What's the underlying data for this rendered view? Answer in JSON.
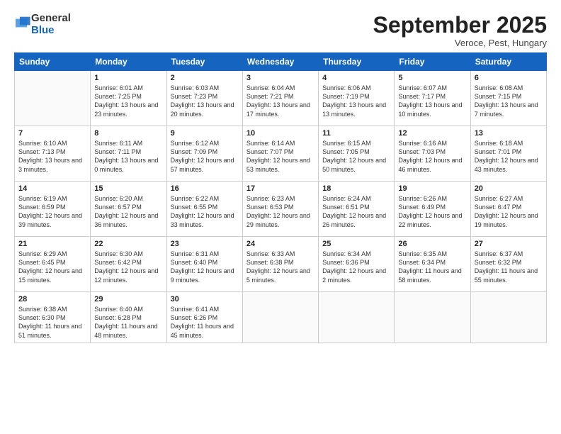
{
  "header": {
    "logo_general": "General",
    "logo_blue": "Blue",
    "title": "September 2025",
    "subtitle": "Veroce, Pest, Hungary"
  },
  "columns": [
    "Sunday",
    "Monday",
    "Tuesday",
    "Wednesday",
    "Thursday",
    "Friday",
    "Saturday"
  ],
  "weeks": [
    [
      {
        "num": "",
        "sunrise": "",
        "sunset": "",
        "daylight": ""
      },
      {
        "num": "1",
        "sunrise": "6:01 AM",
        "sunset": "7:25 PM",
        "daylight": "13 hours and 23 minutes."
      },
      {
        "num": "2",
        "sunrise": "6:03 AM",
        "sunset": "7:23 PM",
        "daylight": "13 hours and 20 minutes."
      },
      {
        "num": "3",
        "sunrise": "6:04 AM",
        "sunset": "7:21 PM",
        "daylight": "13 hours and 17 minutes."
      },
      {
        "num": "4",
        "sunrise": "6:06 AM",
        "sunset": "7:19 PM",
        "daylight": "13 hours and 13 minutes."
      },
      {
        "num": "5",
        "sunrise": "6:07 AM",
        "sunset": "7:17 PM",
        "daylight": "13 hours and 10 minutes."
      },
      {
        "num": "6",
        "sunrise": "6:08 AM",
        "sunset": "7:15 PM",
        "daylight": "13 hours and 7 minutes."
      }
    ],
    [
      {
        "num": "7",
        "sunrise": "6:10 AM",
        "sunset": "7:13 PM",
        "daylight": "13 hours and 3 minutes."
      },
      {
        "num": "8",
        "sunrise": "6:11 AM",
        "sunset": "7:11 PM",
        "daylight": "13 hours and 0 minutes."
      },
      {
        "num": "9",
        "sunrise": "6:12 AM",
        "sunset": "7:09 PM",
        "daylight": "12 hours and 57 minutes."
      },
      {
        "num": "10",
        "sunrise": "6:14 AM",
        "sunset": "7:07 PM",
        "daylight": "12 hours and 53 minutes."
      },
      {
        "num": "11",
        "sunrise": "6:15 AM",
        "sunset": "7:05 PM",
        "daylight": "12 hours and 50 minutes."
      },
      {
        "num": "12",
        "sunrise": "6:16 AM",
        "sunset": "7:03 PM",
        "daylight": "12 hours and 46 minutes."
      },
      {
        "num": "13",
        "sunrise": "6:18 AM",
        "sunset": "7:01 PM",
        "daylight": "12 hours and 43 minutes."
      }
    ],
    [
      {
        "num": "14",
        "sunrise": "6:19 AM",
        "sunset": "6:59 PM",
        "daylight": "12 hours and 39 minutes."
      },
      {
        "num": "15",
        "sunrise": "6:20 AM",
        "sunset": "6:57 PM",
        "daylight": "12 hours and 36 minutes."
      },
      {
        "num": "16",
        "sunrise": "6:22 AM",
        "sunset": "6:55 PM",
        "daylight": "12 hours and 33 minutes."
      },
      {
        "num": "17",
        "sunrise": "6:23 AM",
        "sunset": "6:53 PM",
        "daylight": "12 hours and 29 minutes."
      },
      {
        "num": "18",
        "sunrise": "6:24 AM",
        "sunset": "6:51 PM",
        "daylight": "12 hours and 26 minutes."
      },
      {
        "num": "19",
        "sunrise": "6:26 AM",
        "sunset": "6:49 PM",
        "daylight": "12 hours and 22 minutes."
      },
      {
        "num": "20",
        "sunrise": "6:27 AM",
        "sunset": "6:47 PM",
        "daylight": "12 hours and 19 minutes."
      }
    ],
    [
      {
        "num": "21",
        "sunrise": "6:29 AM",
        "sunset": "6:45 PM",
        "daylight": "12 hours and 15 minutes."
      },
      {
        "num": "22",
        "sunrise": "6:30 AM",
        "sunset": "6:42 PM",
        "daylight": "12 hours and 12 minutes."
      },
      {
        "num": "23",
        "sunrise": "6:31 AM",
        "sunset": "6:40 PM",
        "daylight": "12 hours and 9 minutes."
      },
      {
        "num": "24",
        "sunrise": "6:33 AM",
        "sunset": "6:38 PM",
        "daylight": "12 hours and 5 minutes."
      },
      {
        "num": "25",
        "sunrise": "6:34 AM",
        "sunset": "6:36 PM",
        "daylight": "12 hours and 2 minutes."
      },
      {
        "num": "26",
        "sunrise": "6:35 AM",
        "sunset": "6:34 PM",
        "daylight": "11 hours and 58 minutes."
      },
      {
        "num": "27",
        "sunrise": "6:37 AM",
        "sunset": "6:32 PM",
        "daylight": "11 hours and 55 minutes."
      }
    ],
    [
      {
        "num": "28",
        "sunrise": "6:38 AM",
        "sunset": "6:30 PM",
        "daylight": "11 hours and 51 minutes."
      },
      {
        "num": "29",
        "sunrise": "6:40 AM",
        "sunset": "6:28 PM",
        "daylight": "11 hours and 48 minutes."
      },
      {
        "num": "30",
        "sunrise": "6:41 AM",
        "sunset": "6:26 PM",
        "daylight": "11 hours and 45 minutes."
      },
      {
        "num": "",
        "sunrise": "",
        "sunset": "",
        "daylight": ""
      },
      {
        "num": "",
        "sunrise": "",
        "sunset": "",
        "daylight": ""
      },
      {
        "num": "",
        "sunrise": "",
        "sunset": "",
        "daylight": ""
      },
      {
        "num": "",
        "sunrise": "",
        "sunset": "",
        "daylight": ""
      }
    ]
  ],
  "labels": {
    "sunrise_prefix": "Sunrise: ",
    "sunset_prefix": "Sunset: ",
    "daylight_prefix": "Daylight: "
  }
}
